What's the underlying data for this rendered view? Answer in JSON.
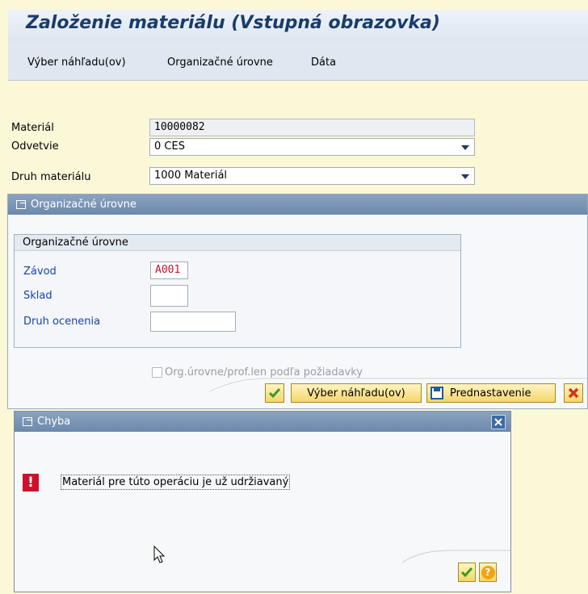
{
  "window": {
    "title": "Založenie materiálu (Vstupná obrazovka)"
  },
  "menu": {
    "items": [
      "Výber náhľadu(ov)",
      "Organizačné úrovne",
      "Dáta"
    ]
  },
  "fields": {
    "material_label": "Materiál",
    "material_value": "10000082",
    "industry_label": "Odvetvie",
    "industry_value": "0 CES",
    "material_type_label": "Druh materiálu",
    "material_type_value": "1000 Materiál"
  },
  "org_dialog": {
    "title": "Organizačné úrovne",
    "group_title": "Organizačné úrovne",
    "plant_label": "Závod",
    "plant_value": "A001",
    "storage_label": "Sklad",
    "storage_value": "",
    "valuation_label": "Druh ocenenia",
    "valuation_value": "",
    "checkbox_label": "Org.úrovne/prof.len podľa požiadavky",
    "checkbox_checked": false,
    "buttons": {
      "views": "Výber náhľadu(ov)",
      "defaults": "Prednastavenie"
    }
  },
  "error_dialog": {
    "title": "Chyba",
    "message": "Materiál pre túto operáciu je už udržiavaný"
  },
  "colors": {
    "background": "#fbf8d8",
    "titlebar": "#6c88ab",
    "label_blue": "#1544b4",
    "error_red": "#d0102b",
    "plant_value_red": "#c8102e"
  },
  "icons": {
    "confirm": "check-icon",
    "save": "save-icon",
    "cancel": "cancel-x-icon",
    "close": "close-icon",
    "help": "help-icon",
    "error": "error-exclamation-icon",
    "cursor": "mouse-pointer-icon"
  }
}
